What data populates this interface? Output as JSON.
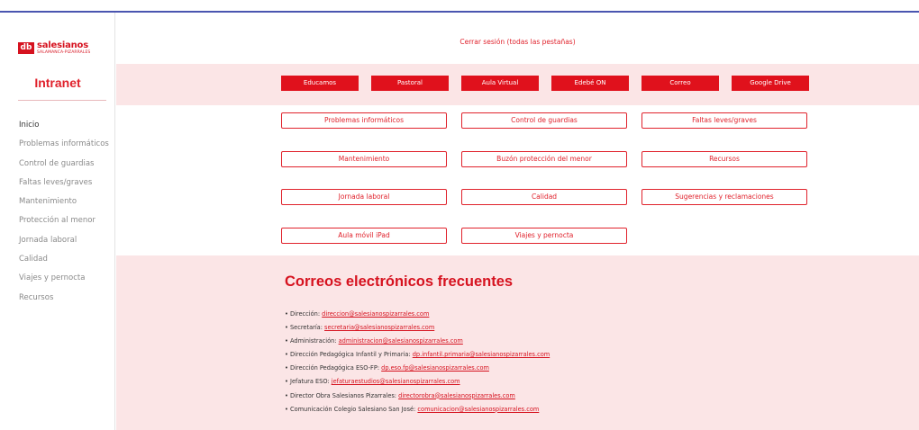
{
  "logo": {
    "mark": "db",
    "name": "salesianos",
    "subtitle": "SALAMANCA-PIZARRALES"
  },
  "sidebar": {
    "title": "Intranet",
    "items": [
      {
        "label": "Inicio"
      },
      {
        "label": "Problemas informáticos"
      },
      {
        "label": "Control de guardias"
      },
      {
        "label": "Faltas leves/graves"
      },
      {
        "label": "Mantenimiento"
      },
      {
        "label": "Protección al menor"
      },
      {
        "label": "Jornada laboral"
      },
      {
        "label": "Calidad"
      },
      {
        "label": "Viajes y pernocta"
      },
      {
        "label": "Recursos"
      }
    ]
  },
  "header": {
    "logout_label": "Cerrar sesión (todas las pestañas)"
  },
  "quick_links": [
    {
      "label": "Educamos"
    },
    {
      "label": "Pastoral"
    },
    {
      "label": "Aula Virtual"
    },
    {
      "label": "Edebé ON"
    },
    {
      "label": "Correo"
    },
    {
      "label": "Google Drive"
    }
  ],
  "sections": [
    {
      "label": "Problemas informáticos"
    },
    {
      "label": "Control de guardias"
    },
    {
      "label": "Faltas leves/graves"
    },
    {
      "label": "Mantenimiento"
    },
    {
      "label": "Buzón protección del menor"
    },
    {
      "label": "Recursos"
    },
    {
      "label": "Jornada laboral"
    },
    {
      "label": "Calidad"
    },
    {
      "label": "Sugerencias y reclamaciones"
    },
    {
      "label": "Aula móvil iPad"
    },
    {
      "label": "Viajes y pernocta"
    }
  ],
  "emails": {
    "title": "Correos electrónicos frecuentes",
    "bullet": "•",
    "items": [
      {
        "label": "Dirección:",
        "email": "direccion@salesianospizarrales.com"
      },
      {
        "label": "Secretaría:",
        "email": "secretaria@salesianospizarrales.com"
      },
      {
        "label": "Administración:",
        "email": "administracion@salesianospizarrales.com"
      },
      {
        "label": "Dirección Pedagógica Infantil y Primaria:",
        "email": "dp.infantil.primaria@salesianospizarrales.com"
      },
      {
        "label": "Dirección Pedagógica ESO-FP:",
        "email": "dp.eso.fp@salesianospizarrales.com"
      },
      {
        "label": "Jefatura ESO:",
        "email": "jefaturaestudios@salesianospizarrales.com"
      },
      {
        "label": "Director Obra Salesianos Pizarrales:",
        "email": "directorobra@salesianospizarrales.com"
      },
      {
        "label": "Comunicación Colegio Salesiano San José:",
        "email": "comunicacion@salesianospizarrales.com"
      }
    ]
  },
  "colors": {
    "accent": "#e0111c",
    "band": "#fbe5e6",
    "top_rule": "#4a55b0"
  }
}
